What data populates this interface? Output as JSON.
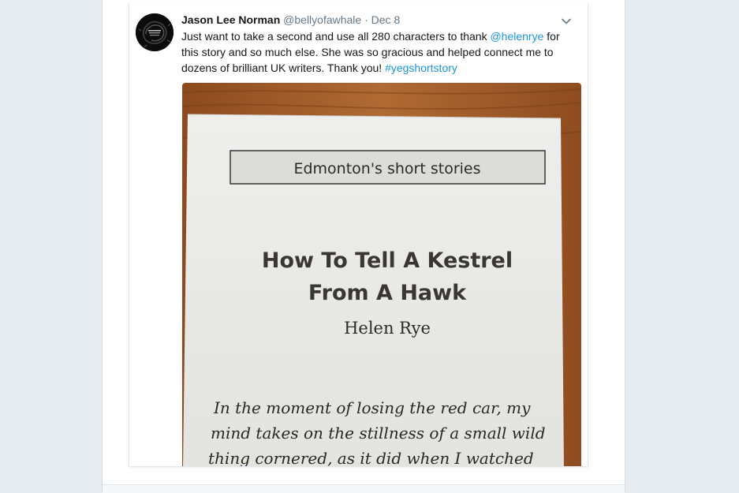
{
  "tweet": {
    "display_name": "Jason Lee Norman",
    "handle": "@bellyofawhale",
    "separator": "·",
    "timestamp": "Dec 8",
    "text_parts": {
      "p1": "Just want to take a second and use all 280 characters to thank ",
      "mention": "@helenrye",
      "p2": " for this story and so much else. She was so gracious and helped connect me to dozens of brilliant UK writers. Thank you! ",
      "hashtag": "#yegshortstory"
    },
    "avatar_icon": "ink-splash-logo-avatar",
    "menu_icon": "chevron-down-icon"
  },
  "photo": {
    "header_box": "Edmonton's short stories",
    "title_line1": "How To Tell A Kestrel",
    "title_line2": "From A Hawk",
    "author": "Helen Rye",
    "body_line1": "In the moment of losing the red car, my",
    "body_line2": "mind takes on the stillness of a small wild",
    "body_line3": "thing cornered, as it did when I watched"
  },
  "colors": {
    "page_bg": "#e6ecf0",
    "link": "#1b95e0",
    "name": "#14171a",
    "meta": "#657786",
    "wood": "#a8602a"
  }
}
